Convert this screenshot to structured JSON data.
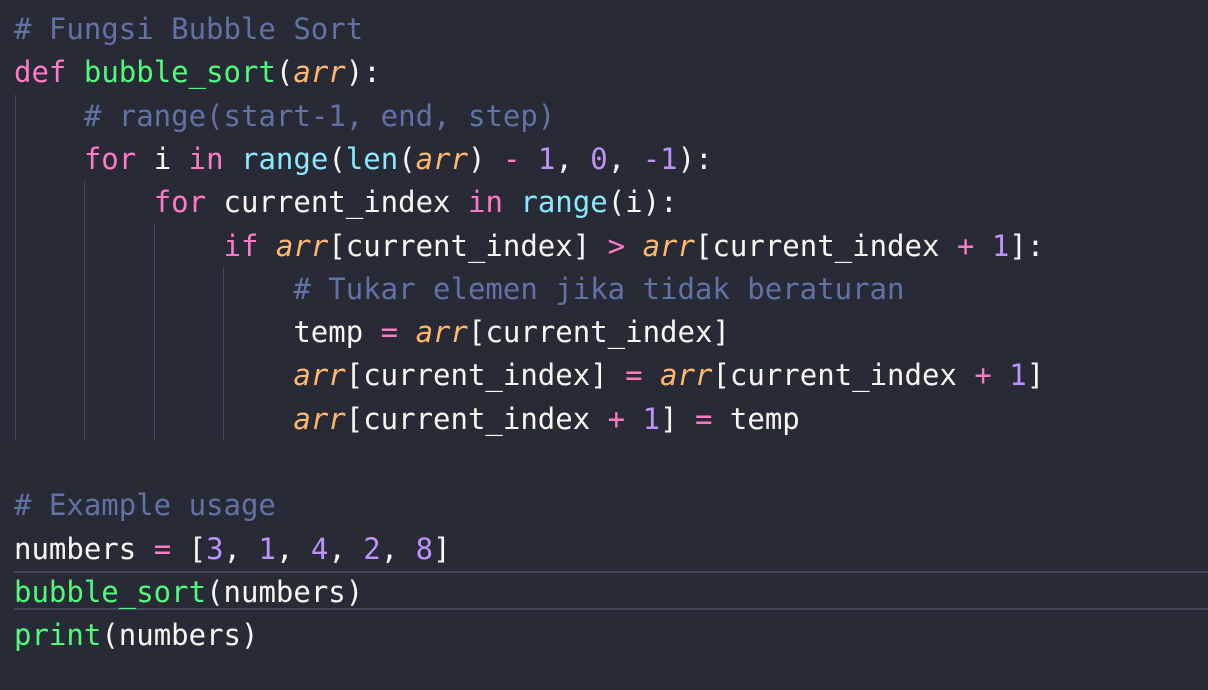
{
  "editor": {
    "theme": {
      "background": "#282a36",
      "foreground": "#f8f8f2",
      "keyword": "#ff79c6",
      "function": "#50fa7b",
      "builtin": "#8be9fd",
      "parameter": "#ffb86c",
      "number": "#bd93f9",
      "comment": "#6272a4"
    },
    "lines": [
      {
        "tokens": [
          {
            "t": "# Fungsi Bubble Sort",
            "k": "com"
          }
        ]
      },
      {
        "tokens": [
          {
            "t": "def",
            "k": "kw"
          },
          {
            "t": " ",
            "k": "txt"
          },
          {
            "t": "bubble_sort",
            "k": "fn"
          },
          {
            "t": "(",
            "k": "txt"
          },
          {
            "t": "arr",
            "k": "param"
          },
          {
            "t": "):",
            "k": "txt"
          }
        ]
      },
      {
        "tokens": [
          {
            "t": "    ",
            "k": "txt"
          },
          {
            "t": "# range(start-1, end, step)",
            "k": "com"
          }
        ]
      },
      {
        "tokens": [
          {
            "t": "    ",
            "k": "txt"
          },
          {
            "t": "for",
            "k": "kw"
          },
          {
            "t": " i ",
            "k": "txt"
          },
          {
            "t": "in",
            "k": "kw"
          },
          {
            "t": " ",
            "k": "txt"
          },
          {
            "t": "range",
            "k": "bi"
          },
          {
            "t": "(",
            "k": "txt"
          },
          {
            "t": "len",
            "k": "bi"
          },
          {
            "t": "(",
            "k": "txt"
          },
          {
            "t": "arr",
            "k": "param"
          },
          {
            "t": ") ",
            "k": "txt"
          },
          {
            "t": "-",
            "k": "op"
          },
          {
            "t": " ",
            "k": "txt"
          },
          {
            "t": "1",
            "k": "num"
          },
          {
            "t": ", ",
            "k": "txt"
          },
          {
            "t": "0",
            "k": "num"
          },
          {
            "t": ", ",
            "k": "txt"
          },
          {
            "t": "-1",
            "k": "num"
          },
          {
            "t": "):",
            "k": "txt"
          }
        ]
      },
      {
        "tokens": [
          {
            "t": "        ",
            "k": "txt"
          },
          {
            "t": "for",
            "k": "kw"
          },
          {
            "t": " current_index ",
            "k": "txt"
          },
          {
            "t": "in",
            "k": "kw"
          },
          {
            "t": " ",
            "k": "txt"
          },
          {
            "t": "range",
            "k": "bi"
          },
          {
            "t": "(i):",
            "k": "txt"
          }
        ]
      },
      {
        "tokens": [
          {
            "t": "            ",
            "k": "txt"
          },
          {
            "t": "if",
            "k": "kw"
          },
          {
            "t": " ",
            "k": "txt"
          },
          {
            "t": "arr",
            "k": "param"
          },
          {
            "t": "[current_index] ",
            "k": "txt"
          },
          {
            "t": ">",
            "k": "op"
          },
          {
            "t": " ",
            "k": "txt"
          },
          {
            "t": "arr",
            "k": "param"
          },
          {
            "t": "[current_index ",
            "k": "txt"
          },
          {
            "t": "+",
            "k": "op"
          },
          {
            "t": " ",
            "k": "txt"
          },
          {
            "t": "1",
            "k": "num"
          },
          {
            "t": "]:",
            "k": "txt"
          }
        ]
      },
      {
        "tokens": [
          {
            "t": "                ",
            "k": "txt"
          },
          {
            "t": "# Tukar elemen jika tidak beraturan",
            "k": "com"
          }
        ]
      },
      {
        "tokens": [
          {
            "t": "                temp ",
            "k": "txt"
          },
          {
            "t": "=",
            "k": "op"
          },
          {
            "t": " ",
            "k": "txt"
          },
          {
            "t": "arr",
            "k": "param"
          },
          {
            "t": "[current_index]",
            "k": "txt"
          }
        ]
      },
      {
        "tokens": [
          {
            "t": "                ",
            "k": "txt"
          },
          {
            "t": "arr",
            "k": "param"
          },
          {
            "t": "[current_index] ",
            "k": "txt"
          },
          {
            "t": "=",
            "k": "op"
          },
          {
            "t": " ",
            "k": "txt"
          },
          {
            "t": "arr",
            "k": "param"
          },
          {
            "t": "[current_index ",
            "k": "txt"
          },
          {
            "t": "+",
            "k": "op"
          },
          {
            "t": " ",
            "k": "txt"
          },
          {
            "t": "1",
            "k": "num"
          },
          {
            "t": "]",
            "k": "txt"
          }
        ]
      },
      {
        "tokens": [
          {
            "t": "                ",
            "k": "txt"
          },
          {
            "t": "arr",
            "k": "param"
          },
          {
            "t": "[current_index ",
            "k": "txt"
          },
          {
            "t": "+",
            "k": "op"
          },
          {
            "t": " ",
            "k": "txt"
          },
          {
            "t": "1",
            "k": "num"
          },
          {
            "t": "] ",
            "k": "txt"
          },
          {
            "t": "=",
            "k": "op"
          },
          {
            "t": " temp",
            "k": "txt"
          }
        ]
      },
      {
        "tokens": []
      },
      {
        "tokens": [
          {
            "t": "# Example usage",
            "k": "com"
          }
        ]
      },
      {
        "tokens": [
          {
            "t": "numbers ",
            "k": "txt"
          },
          {
            "t": "=",
            "k": "op"
          },
          {
            "t": " [",
            "k": "txt"
          },
          {
            "t": "3",
            "k": "num"
          },
          {
            "t": ", ",
            "k": "txt"
          },
          {
            "t": "1",
            "k": "num"
          },
          {
            "t": ", ",
            "k": "txt"
          },
          {
            "t": "4",
            "k": "num"
          },
          {
            "t": ", ",
            "k": "txt"
          },
          {
            "t": "2",
            "k": "num"
          },
          {
            "t": ", ",
            "k": "txt"
          },
          {
            "t": "8",
            "k": "num"
          },
          {
            "t": "]",
            "k": "txt"
          }
        ]
      },
      {
        "tokens": [
          {
            "t": "bubble_sort",
            "k": "fn"
          },
          {
            "t": "(numbers)",
            "k": "txt"
          }
        ]
      },
      {
        "tokens": [
          {
            "t": "print",
            "k": "fn"
          },
          {
            "t": "(numbers)",
            "k": "txt"
          }
        ]
      }
    ]
  }
}
